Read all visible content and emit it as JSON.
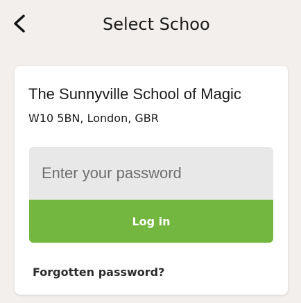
{
  "nav": {
    "title": "Select School",
    "back_icon": "chevron-left-icon"
  },
  "school": {
    "name": "The Sunnyville School of Magic",
    "address": "W10 5BN, London, GBR"
  },
  "login": {
    "password_placeholder": "Enter your password",
    "button_label": "Log in",
    "forgot_label": "Forgotten password?"
  },
  "colors": {
    "background": "#f2efed",
    "card": "#ffffff",
    "input_bg": "#e8e8e8",
    "accent_green": "#73b740"
  }
}
